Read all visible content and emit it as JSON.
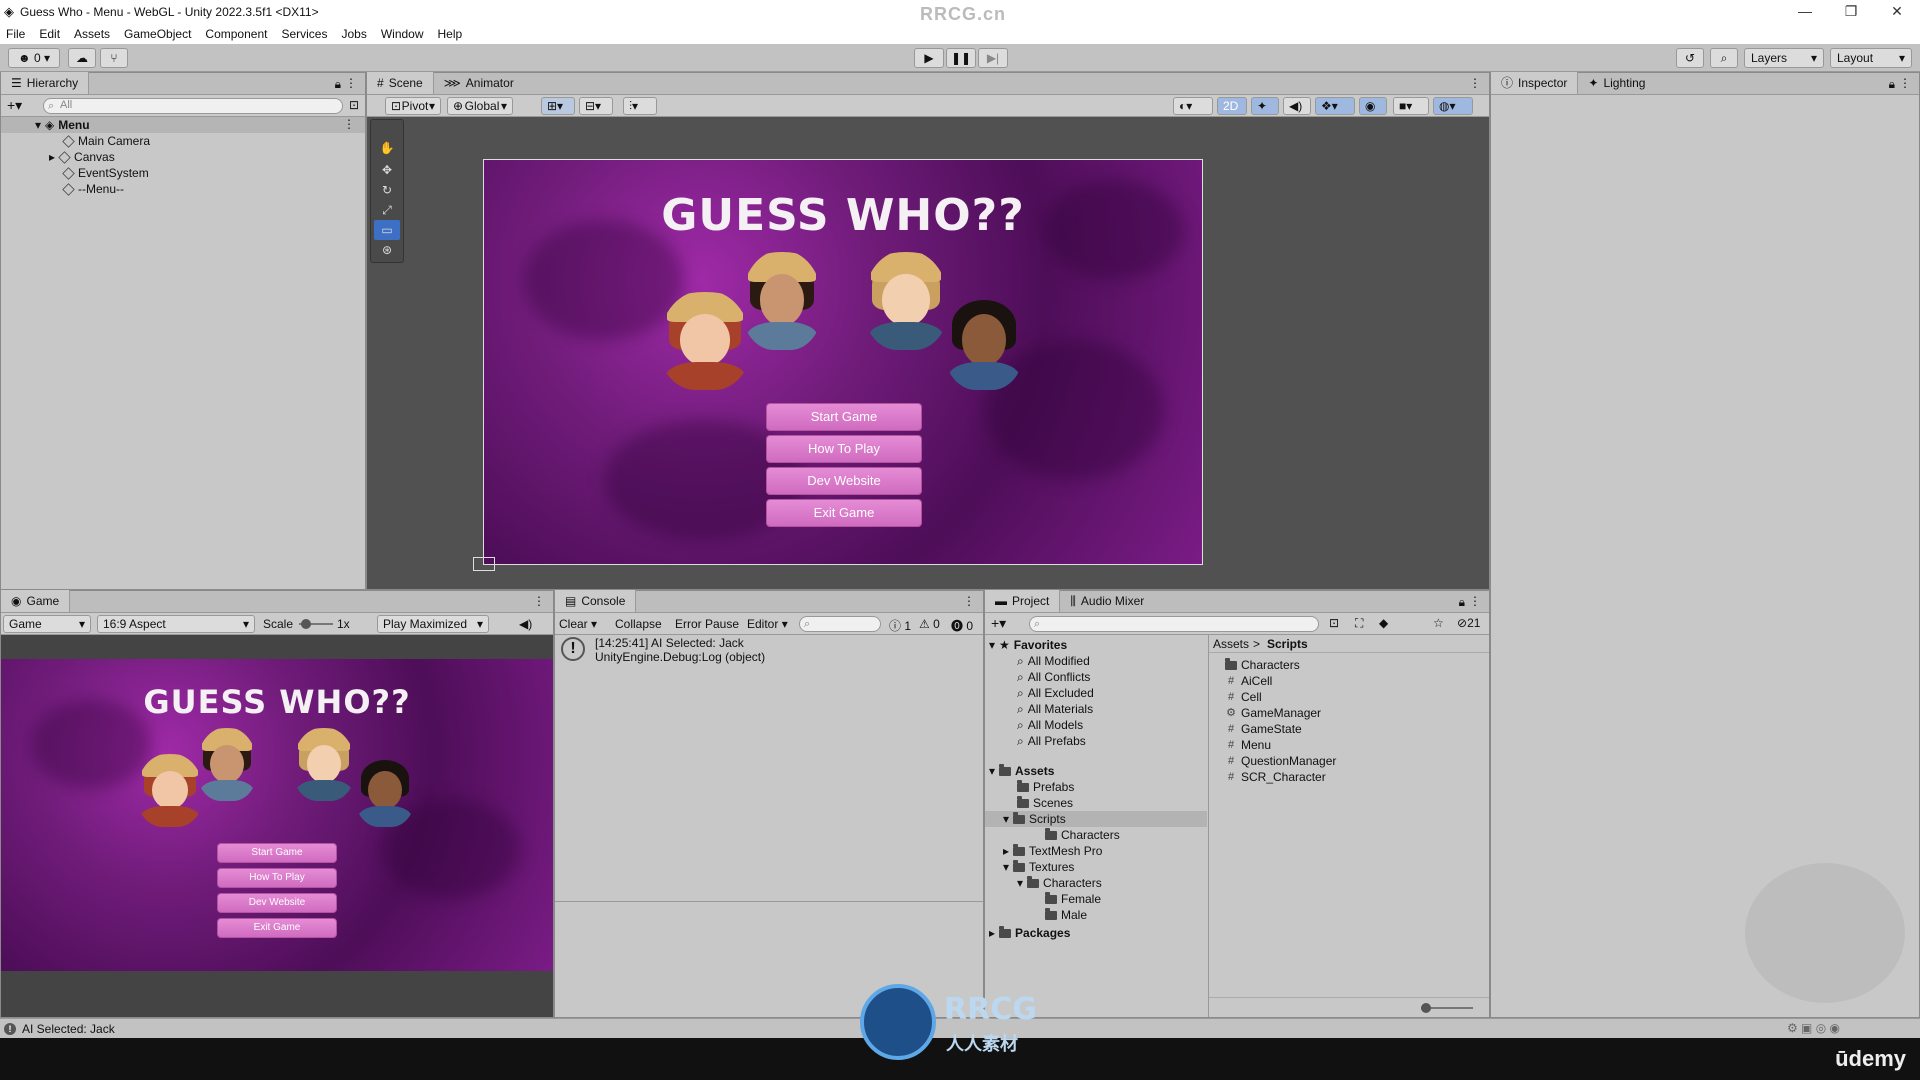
{
  "window": {
    "title": "Guess Who - Menu - WebGL - Unity 2022.3.5f1 <DX11>",
    "watermark": "RRCG.cn",
    "controls": [
      "—",
      "❐",
      "✕"
    ]
  },
  "menubar": [
    "File",
    "Edit",
    "Assets",
    "GameObject",
    "Component",
    "Services",
    "Jobs",
    "Window",
    "Help"
  ],
  "toolbar": {
    "account_count": "0",
    "layers_label": "Layers",
    "layout_label": "Layout"
  },
  "hierarchy": {
    "tab_label": "Hierarchy",
    "search_placeholder": "All",
    "scene_name": "Menu",
    "items": [
      {
        "label": "Main Camera"
      },
      {
        "label": "Canvas"
      },
      {
        "label": "EventSystem"
      },
      {
        "label": "--Menu--"
      }
    ]
  },
  "scene_panel": {
    "tabs": [
      {
        "label": "Scene"
      },
      {
        "label": "Animator"
      }
    ],
    "pivot_label": "Pivot",
    "global_label": "Global",
    "mode_2d_label": "2D"
  },
  "inspector_panel": {
    "tabs": [
      {
        "label": "Inspector"
      },
      {
        "label": "Lighting"
      }
    ]
  },
  "game_ui": {
    "title": "GUESS WHO??",
    "buttons": [
      {
        "label": "Start Game"
      },
      {
        "label": "How To Play"
      },
      {
        "label": "Dev Website"
      },
      {
        "label": "Exit Game"
      }
    ]
  },
  "game_panel": {
    "tab_label": "Game",
    "display_label": "Game",
    "aspect_label": "16:9 Aspect",
    "scale_label": "Scale",
    "scale_value": "1x",
    "play_mode_label": "Play Maximized"
  },
  "console": {
    "tab_label": "Console",
    "clear_label": "Clear",
    "collapse_label": "Collapse",
    "error_pause_label": "Error Pause",
    "editor_label": "Editor",
    "count_info": "1",
    "count_warn": "0",
    "count_error": "0",
    "entries": [
      {
        "line1": "[14:25:41] AI Selected: Jack",
        "line2": "UnityEngine.Debug:Log (object)"
      }
    ]
  },
  "project": {
    "tabs": [
      {
        "label": "Project"
      },
      {
        "label": "Audio Mixer"
      }
    ],
    "hidden_count": "21",
    "favorites_label": "Favorites",
    "favorites": [
      {
        "label": "All Modified"
      },
      {
        "label": "All Conflicts"
      },
      {
        "label": "All Excluded"
      },
      {
        "label": "All Materials"
      },
      {
        "label": "All Models"
      },
      {
        "label": "All Prefabs"
      }
    ],
    "assets_label": "Assets",
    "asset_tree": [
      {
        "label": "Prefabs"
      },
      {
        "label": "Scenes"
      },
      {
        "label": "Scripts"
      },
      {
        "label": "Characters"
      },
      {
        "label": "TextMesh Pro"
      },
      {
        "label": "Textures"
      },
      {
        "label": "Characters"
      },
      {
        "label": "Female"
      },
      {
        "label": "Male"
      }
    ],
    "packages_label": "Packages",
    "breadcrumb": {
      "root": "Assets",
      "sep": ">",
      "current": "Scripts"
    },
    "files": [
      {
        "label": "Characters"
      },
      {
        "label": "AiCell"
      },
      {
        "label": "Cell"
      },
      {
        "label": "GameManager"
      },
      {
        "label": "GameState"
      },
      {
        "label": "Menu"
      },
      {
        "label": "QuestionManager"
      },
      {
        "label": "SCR_Character"
      }
    ]
  },
  "statusbar": {
    "message": "AI Selected: Jack"
  },
  "overlay": {
    "logo_text": "RRCG",
    "logo_sub": "人人素材",
    "udemy": "ūdemy"
  },
  "colors": {
    "purple_dark": "#4e0e58",
    "purple_mid": "#8a2494",
    "button_pink": "#d877c9",
    "selection_blue": "#3d6fc4"
  }
}
